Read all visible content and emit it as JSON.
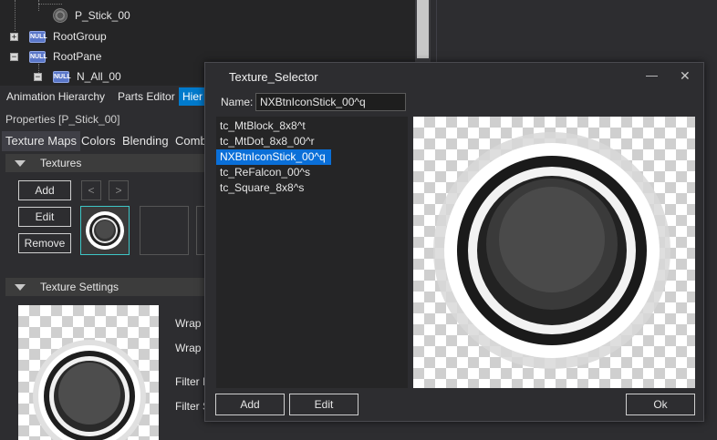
{
  "tree": {
    "rows": [
      {
        "label": "P_Stick_00"
      },
      {
        "label": "RootGroup",
        "badge": "NULL",
        "expander": "+"
      },
      {
        "label": "RootPane",
        "badge": "NULL",
        "expander": "−"
      },
      {
        "label": "N_All_00",
        "badge": "NULL",
        "expander": "−"
      }
    ]
  },
  "panel_tabs": [
    "Animation Hierarchy",
    "Parts Editor",
    "Hier"
  ],
  "properties": {
    "title": "Properties [P_Stick_00]",
    "subtabs": [
      "Texture Maps",
      "Colors",
      "Blending",
      "Comb"
    ],
    "textures_header": "Textures",
    "add_label": "Add",
    "edit_label": "Edit",
    "remove_label": "Remove",
    "prev_glyph": "<",
    "next_glyph": ">",
    "texture_settings_header": "Texture Settings",
    "settings_labels": [
      "Wrap M",
      "Wrap M",
      "Filter E",
      "Filter S"
    ]
  },
  "dialog": {
    "title": "Texture_Selector",
    "minimize_glyph": "—",
    "close_glyph": "✕",
    "name_label": "Name:",
    "name_value": "NXBtnIconStick_00^q",
    "items": [
      "tc_MtBlock_8x8^t",
      "tc_MtDot_8x8_00^r",
      "NXBtnIconStick_00^q",
      "tc_ReFalcon_00^s",
      "tc_Square_8x8^s"
    ],
    "selected_index": 2,
    "add_label": "Add",
    "edit_label": "Edit",
    "ok_label": "Ok"
  },
  "colors": {
    "accent": "#0a6fd8",
    "thumb_border": "#3ec6c6"
  }
}
